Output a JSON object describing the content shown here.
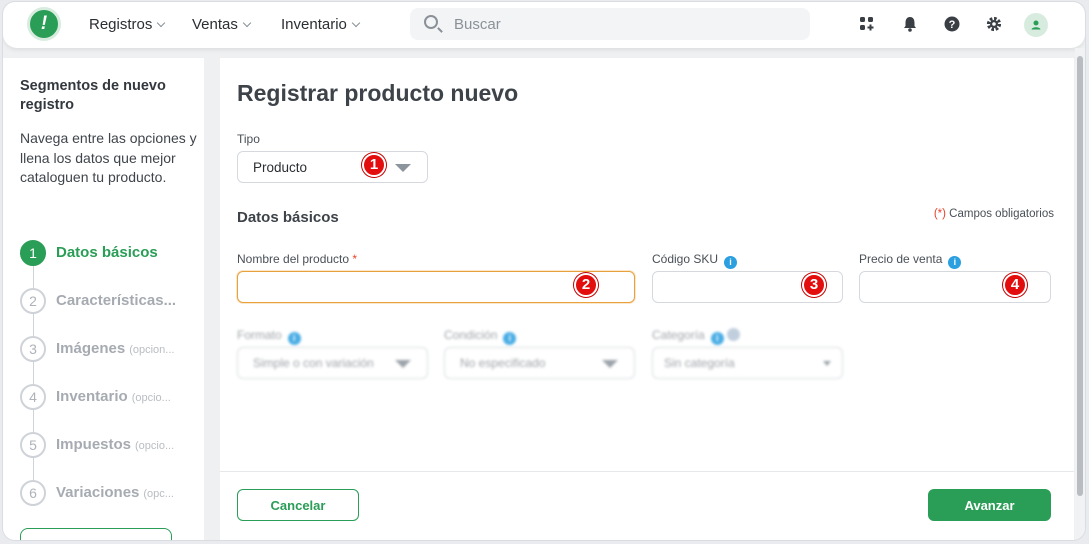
{
  "header": {
    "logo_text": "!",
    "nav": [
      {
        "label": "Registros"
      },
      {
        "label": "Ventas"
      },
      {
        "label": "Inventario"
      }
    ],
    "search": {
      "placeholder": "Buscar"
    },
    "icons": [
      "apps-icon",
      "bell-icon",
      "help-icon",
      "gear-icon",
      "user-avatar-icon"
    ]
  },
  "sidebar": {
    "title": "Segmentos de nuevo registro",
    "description": "Navega entre las opciones y llena los datos que mejor cataloguen tu producto.",
    "steps": [
      {
        "number": "1",
        "label": "Datos básicos",
        "optional": "",
        "active": true
      },
      {
        "number": "2",
        "label": "Características...",
        "optional": "",
        "active": false
      },
      {
        "number": "3",
        "label": "Imágenes",
        "optional": "(opcion...",
        "active": false
      },
      {
        "number": "4",
        "label": "Inventario",
        "optional": "(opcio...",
        "active": false
      },
      {
        "number": "5",
        "label": "Impuestos",
        "optional": "(opcio...",
        "active": false
      },
      {
        "number": "6",
        "label": "Variaciones",
        "optional": "(opc...",
        "active": false
      }
    ]
  },
  "main": {
    "title": "Registrar producto nuevo",
    "tipo": {
      "label": "Tipo",
      "value": "Producto"
    },
    "section_title": "Datos básicos",
    "required_note": {
      "marker": "(*)",
      "text": " Campos obligatorios"
    },
    "fields": {
      "nombre": {
        "label": "Nombre del producto",
        "required_mark": "*",
        "value": ""
      },
      "sku": {
        "label": "Código SKU",
        "value": ""
      },
      "precio": {
        "label": "Precio de venta",
        "value": ""
      }
    },
    "blurred": {
      "formato": {
        "label": "Formato",
        "value": "Simple o con variación"
      },
      "condicion": {
        "label": "Condición",
        "value": "No especificado"
      },
      "categoria": {
        "label": "Categoría",
        "value": "Sin categoría"
      }
    },
    "annotations": [
      "1",
      "2",
      "3",
      "4"
    ],
    "buttons": {
      "cancel": "Cancelar",
      "next": "Avanzar"
    }
  },
  "colors": {
    "brand": "#2a9d57",
    "focus": "#e9a13b",
    "annotation": "#e30d0d",
    "info": "#2b9fe0"
  }
}
